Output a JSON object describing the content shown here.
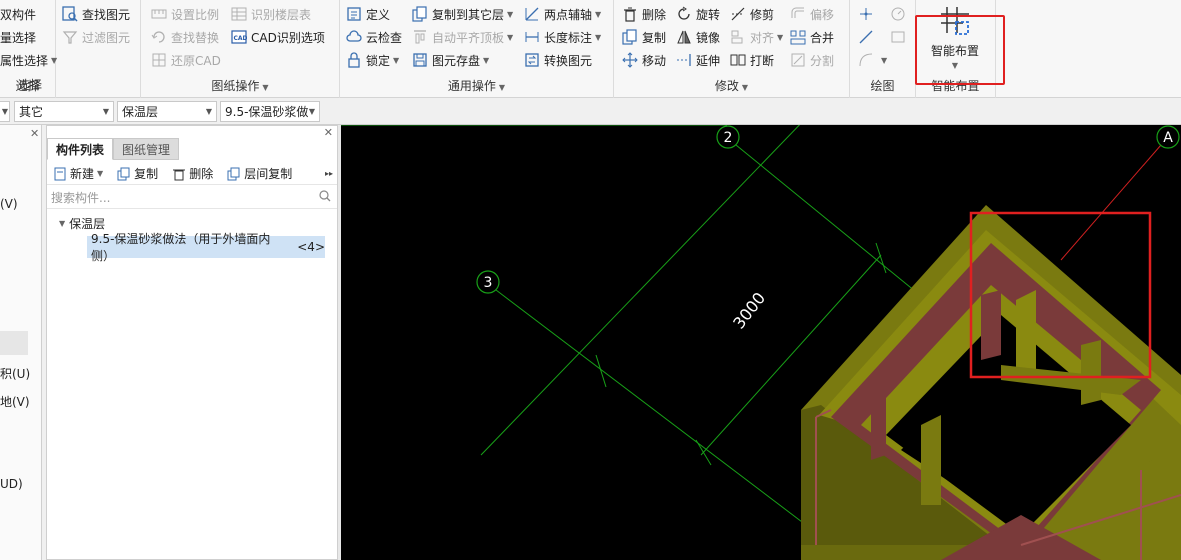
{
  "ribbon": {
    "group_select": {
      "title": "选择",
      "items": [
        "双构件",
        "量选择",
        "属性选择"
      ],
      "find_element": "查找图元",
      "filter_element": "过滤图元"
    },
    "group_drawing": {
      "title": "图纸操作",
      "set_scale": "设置比例",
      "find_replace": "查找替换",
      "restore_cad": "还原CAD",
      "recognize_floor_table": "识别楼层表",
      "cad_recognize_options": "CAD识别选项"
    },
    "group_common": {
      "title": "通用操作",
      "define": "定义",
      "cloud_check": "云检查",
      "lock": "锁定",
      "copy_to_other_floor": "复制到其它层",
      "auto_align_top": "自动平齐顶板",
      "element_save": "图元存盘",
      "two_point_axis": "两点辅轴",
      "length_dimension": "长度标注",
      "convert_element": "转换图元"
    },
    "group_modify": {
      "title": "修改",
      "delete": "删除",
      "copy": "复制",
      "move": "移动",
      "rotate": "旋转",
      "mirror": "镜像",
      "extend": "延伸",
      "trim": "修剪",
      "align": "对齐",
      "break": "打断",
      "offset": "偏移",
      "merge": "合并",
      "split": "分割"
    },
    "group_draw": {
      "title": "绘图"
    },
    "group_smart": {
      "title": "智能布置",
      "button": "智能布置"
    }
  },
  "toolbar2": {
    "combo_other": "其它",
    "combo_layer": "保温层",
    "combo_element": "9.5-保温砂浆做"
  },
  "left_strip": {
    "items": [
      "(V)",
      "积(U)",
      "地(V)",
      "UD)"
    ]
  },
  "panel": {
    "tab_component_list": "构件列表",
    "tab_drawing_mgmt": "图纸管理",
    "new": "新建",
    "copy": "复制",
    "delete": "删除",
    "floor_copy": "层间复制",
    "search_placeholder": "搜索构件...",
    "tree_group": "保温层",
    "tree_item": "9.5-保温砂浆做法（用于外墙面内侧）",
    "tree_item_count": "<4>"
  },
  "canvas": {
    "axis_2": "2",
    "axis_3": "3",
    "axis_A": "A",
    "dimension": "3000"
  },
  "colors": {
    "grid_green": "#18a018",
    "wall_olive": "#8a8a10",
    "beam_maroon": "#7a3a3a",
    "highlight_red": "#e02020"
  }
}
